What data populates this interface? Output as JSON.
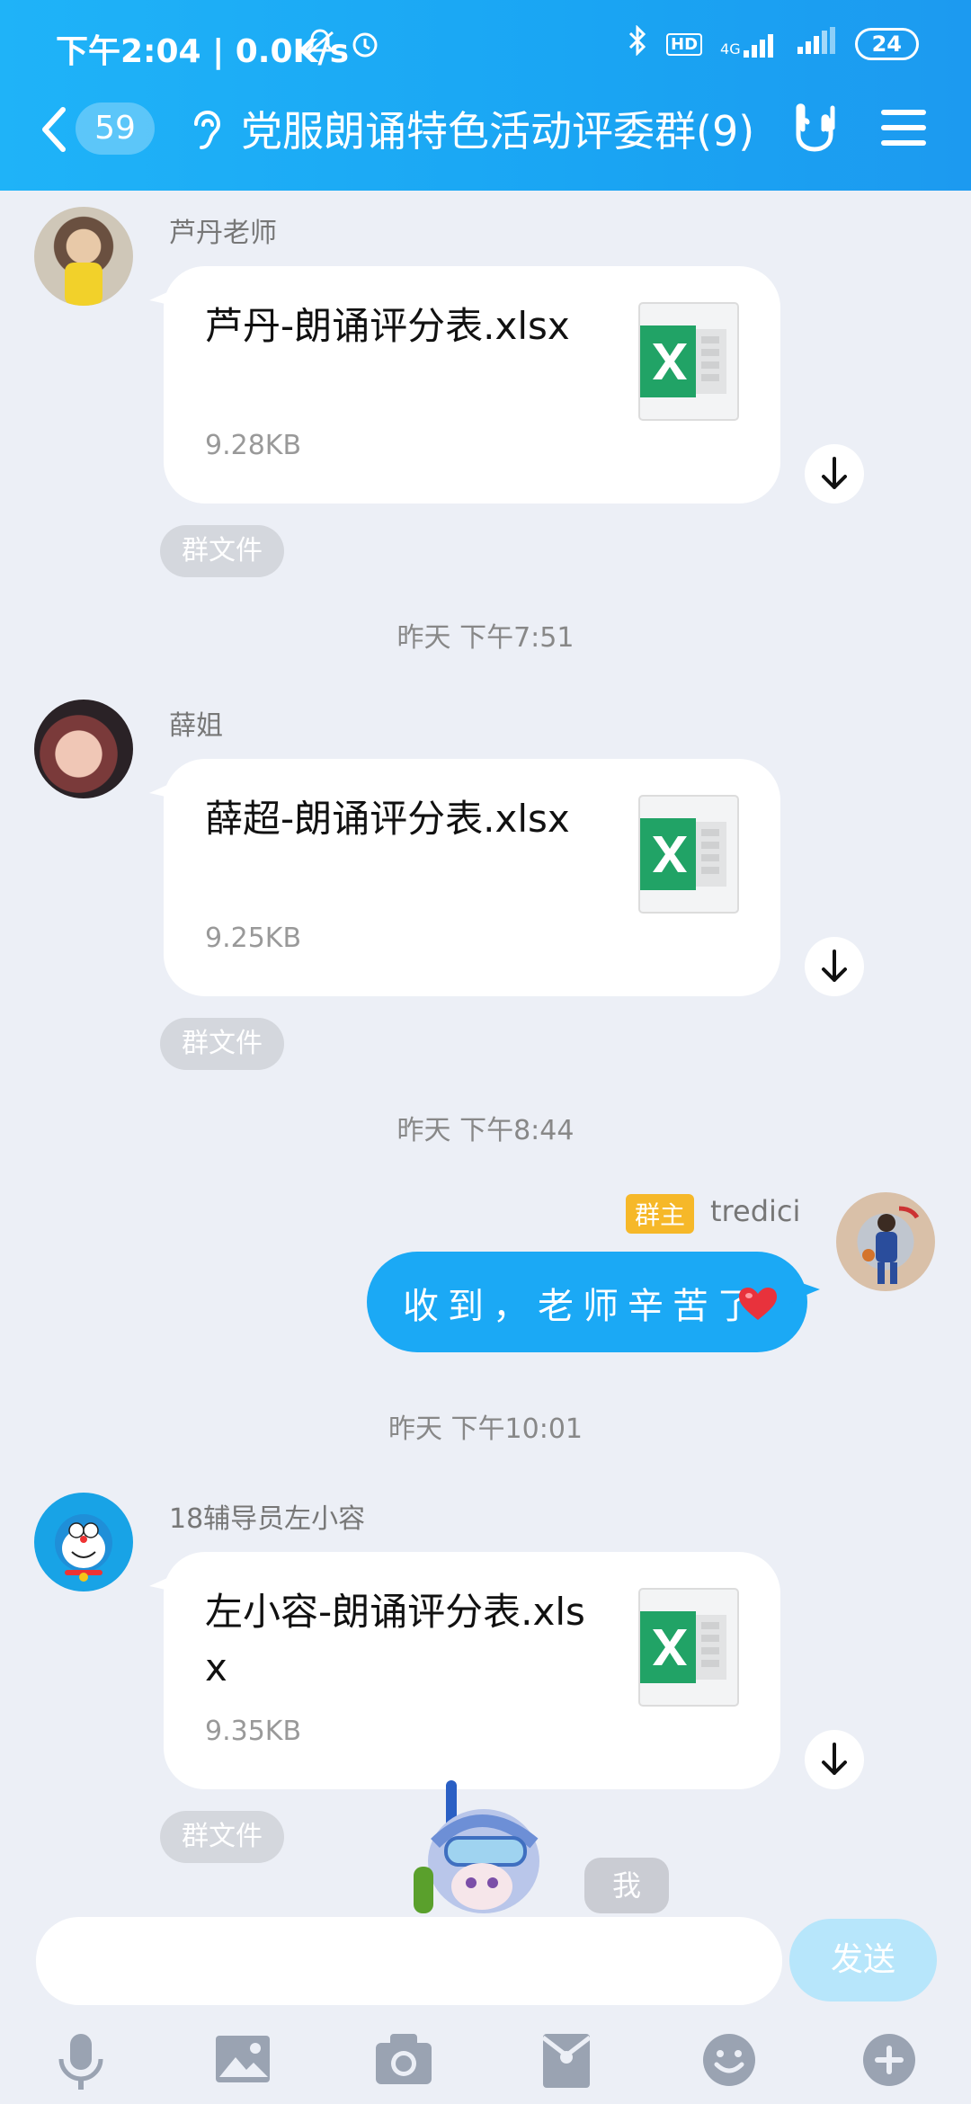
{
  "status_bar": {
    "left_text": "下午2:04 | 0.0K/s",
    "battery": "24",
    "hd": "HD",
    "network": "4G"
  },
  "header": {
    "unread_count": "59",
    "title": "党服朗诵特色活动评委群(9)"
  },
  "messages": [
    {
      "sender": "芦丹老师",
      "file_name": "芦丹-朗诵评分表.xlsx",
      "file_size": "9.28KB",
      "tag": "群文件"
    },
    {
      "timestamp": "昨天 下午7:51"
    },
    {
      "sender": "薛姐",
      "file_name": "薛超-朗诵评分表.xlsx",
      "file_size": "9.25KB",
      "tag": "群文件"
    },
    {
      "timestamp": "昨天 下午8:44"
    },
    {
      "owner_badge": "群主",
      "sender": "tredici",
      "text": "收到，老师辛苦了"
    },
    {
      "timestamp": "昨天 下午10:01"
    },
    {
      "sender": "18辅导员左小容",
      "file_name": "左小容-朗诵评分表.xlsx",
      "file_size": "9.35KB",
      "tag": "群文件"
    }
  ],
  "sticker_label": "我",
  "input": {
    "value": "",
    "placeholder": ""
  },
  "send_label": "发送",
  "toolbar_icons": [
    "microphone-icon",
    "image-icon",
    "camera-icon",
    "red-packet-icon",
    "emoji-icon",
    "plus-icon"
  ],
  "colors": {
    "header_blue": "#1aa5f3",
    "my_bubble": "#1ba9f5",
    "owner_badge": "#f6b829",
    "excel_green": "#21a366"
  }
}
